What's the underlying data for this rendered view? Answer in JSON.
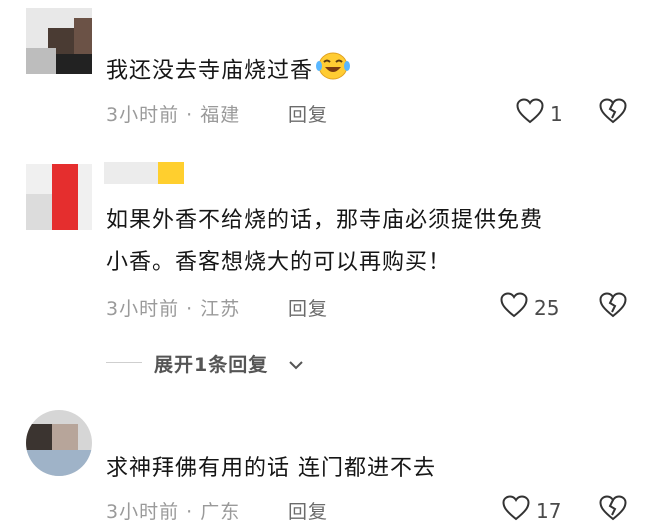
{
  "comments": [
    {
      "content": "我还没去寺庙烧过香",
      "emoji": "laughing-tears-emoji",
      "meta": "3小时前 · 福建",
      "reply": "回复",
      "likes": "1"
    },
    {
      "content_line1": "如果外香不给烧的话，那寺庙必须提供免费",
      "content_line2": "小香。香客想烧大的可以再购买！",
      "meta": "3小时前 · 江苏",
      "reply": "回复",
      "likes": "25"
    },
    {
      "content": "求神拜佛有用的话 连门都进不去",
      "meta": "3小时前 · 广东",
      "reply": "回复",
      "likes": "17"
    }
  ],
  "expand_replies": "展开1条回复",
  "colors": {
    "meta": "#9a9a9a",
    "reply": "#6b6b6b",
    "accent_red": "#e52e2e",
    "accent_yellow": "#ffcf2e"
  }
}
